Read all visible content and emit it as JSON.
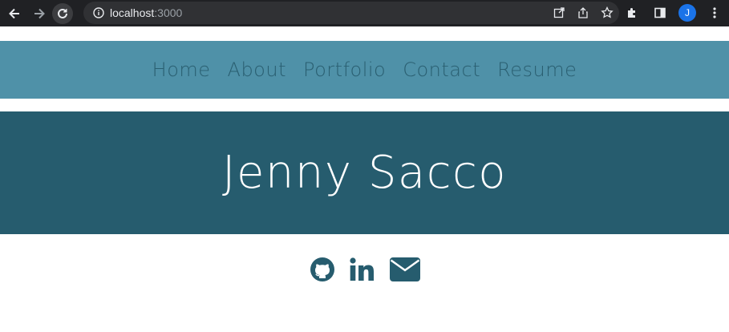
{
  "browser": {
    "url_host": "localhost",
    "url_port": ":3000",
    "profile_initial": "J"
  },
  "nav": {
    "items": [
      "Home",
      "About",
      "Portfolio",
      "Contact",
      "Resume"
    ]
  },
  "hero": {
    "title": "Jenny Sacco"
  },
  "socials": {
    "icons": [
      "github-icon",
      "linkedin-icon",
      "envelope-icon"
    ]
  },
  "colors": {
    "nav_bg": "#4f91a8",
    "nav_text": "#2a5f71",
    "hero_bg": "#265c6e",
    "icon": "#265c6e"
  }
}
